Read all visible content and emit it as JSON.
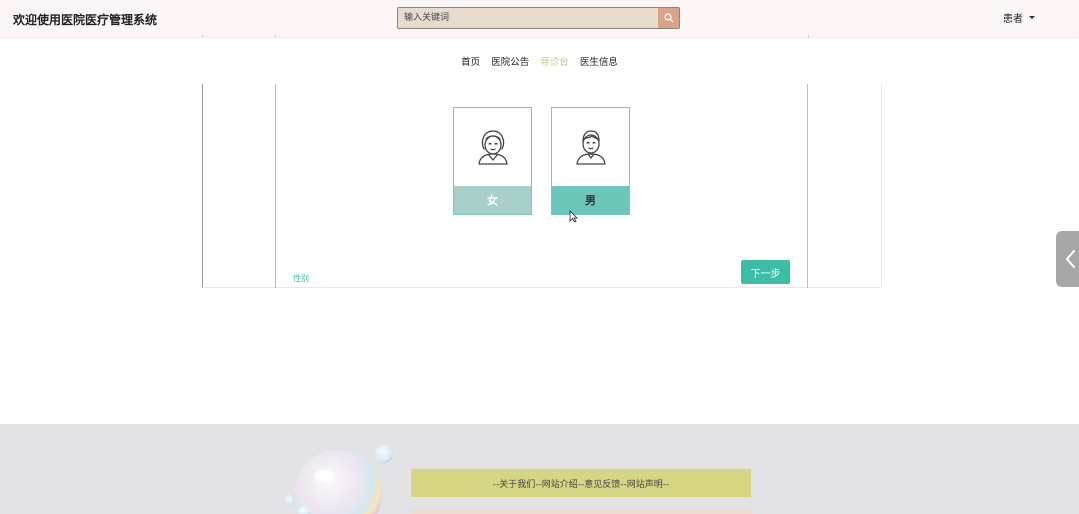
{
  "header": {
    "title": "欢迎使用医院医疗管理系统",
    "search_placeholder": "输入关键词",
    "user_label": "患者"
  },
  "nav": {
    "items": [
      {
        "label": "首页",
        "active": false
      },
      {
        "label": "医院公告",
        "active": false
      },
      {
        "label": "导诊台",
        "active": true
      },
      {
        "label": "医生信息",
        "active": false
      }
    ]
  },
  "triage": {
    "options": [
      {
        "label": "女",
        "icon": "female-avatar-icon"
      },
      {
        "label": "男",
        "icon": "male-avatar-icon"
      }
    ],
    "step_label": "性别",
    "next_button": "下一步"
  },
  "footer": {
    "links_text": "--关于我们--网站介绍--意见反馈--网站声明--"
  },
  "colors": {
    "accent": "#3dbca6",
    "nav_active": "#c2c98a",
    "footer_bg": "#e3e2e4",
    "footer_links_bg": "#d6d584"
  }
}
